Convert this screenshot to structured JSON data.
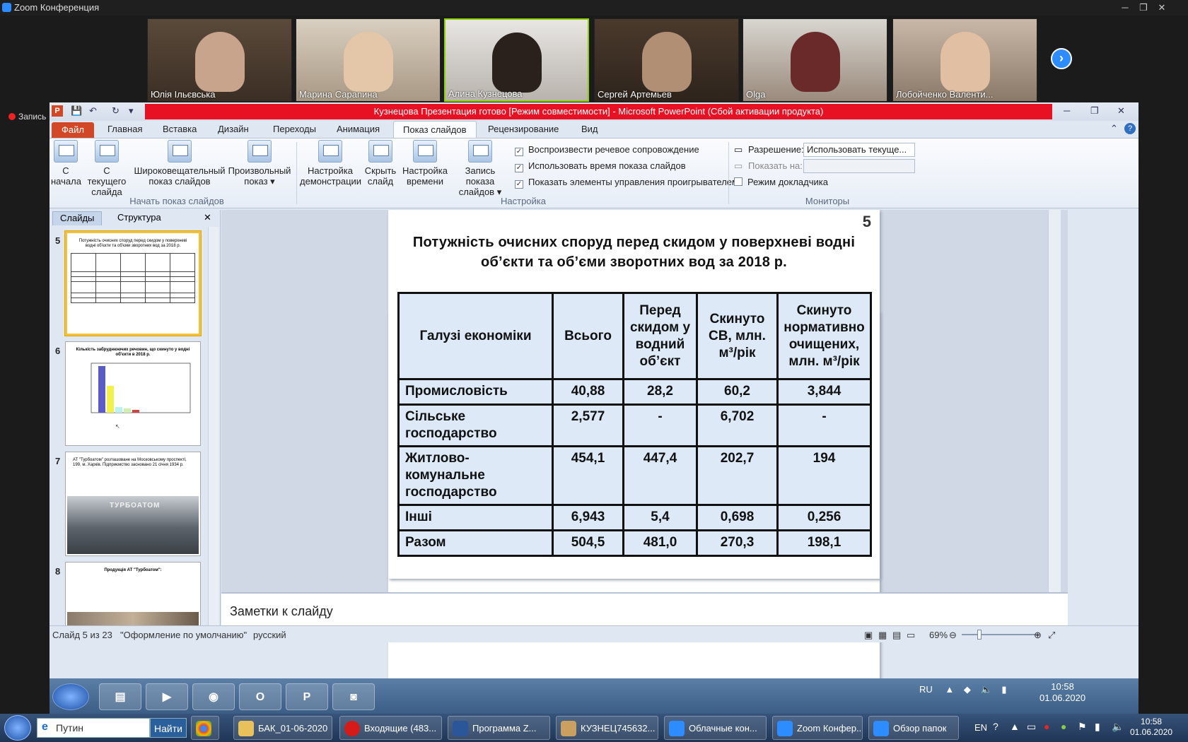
{
  "zoom": {
    "window_title": "Zoom Конференция",
    "recording_label": "Запись",
    "participants": [
      {
        "name": "Юлія Ільєвська"
      },
      {
        "name": "Марина Сарапина"
      },
      {
        "name": "Алина Кузнецова"
      },
      {
        "name": "Сергей Артемьев"
      },
      {
        "name": "Olga"
      },
      {
        "name": "Лобойченко Валенти..."
      }
    ]
  },
  "powerpoint": {
    "title": "Кузнецова Презентация готово [Режим совместимости] - Microsoft PowerPoint (Сбой активации продукта)",
    "tabs": [
      "Файл",
      "Главная",
      "Вставка",
      "Дизайн",
      "Переходы",
      "Анимация",
      "Показ слайдов",
      "Рецензирование",
      "Вид"
    ],
    "ribbon": {
      "start_group": {
        "label": "Начать показ слайдов",
        "buttons": [
          {
            "label1": "С",
            "label2": "начала"
          },
          {
            "label1": "С текущего",
            "label2": "слайда"
          },
          {
            "label1": "Широковещательный",
            "label2": "показ слайдов"
          },
          {
            "label1": "Произвольный",
            "label2": "показ ▾"
          }
        ]
      },
      "setup_group": {
        "label": "Настройка",
        "buttons": [
          {
            "label1": "Настройка",
            "label2": "демонстрации"
          },
          {
            "label1": "Скрыть",
            "label2": "слайд"
          },
          {
            "label1": "Настройка",
            "label2": "времени"
          },
          {
            "label1": "Запись показа",
            "label2": "слайдов ▾"
          }
        ],
        "checkboxes": [
          {
            "label": "Воспроизвести речевое сопровождение",
            "checked": "✓"
          },
          {
            "label": "Использовать время показа слайдов",
            "checked": "✓"
          },
          {
            "label": "Показать элементы управления проигрывателем",
            "checked": "✓"
          }
        ]
      },
      "monitors_group": {
        "label": "Мониторы",
        "resolution_label": "Разрешение:",
        "resolution_value": "Использовать текуще...",
        "show_on_label": "Показать на:",
        "show_on_value": "",
        "presenter_label": "Режим докладчика"
      }
    },
    "left_panel": {
      "tab_slides": "Слайды",
      "tab_outline": "Структура",
      "close": "✕",
      "thumbs": [
        {
          "num": "5",
          "title": "Потужність очисних споруд перед скидом у поверхневі водні об'єкти та об'єми зворотних вод за 2018 р."
        },
        {
          "num": "6",
          "title": "Кількість забруднюючих речовин, що скинуто у водні об'єкти в 2018 р."
        },
        {
          "num": "7",
          "title": "АТ \"Турбоатом\" розташоване на Московському проспекті, 199, м. Харків. Підприємство засновано 21 січня 1934 р.",
          "caption": "ТУРБОАТОМ"
        },
        {
          "num": "8",
          "title": "Продукція АТ \"Турбоатом\":"
        }
      ]
    },
    "slide": {
      "number": "5",
      "title": "Потужність очисних споруд перед скидом у поверхневі водні об’єкти та об’єми зворотних вод за 2018 р.",
      "headers": [
        "Галузі економіки",
        "Всього",
        "Перед скидом у водний об’єкт",
        "Скинуто СВ, млн. м³/рік",
        "Скинуто нормативно очищених, млн. м³/рік"
      ],
      "rows": [
        [
          "Промисловість",
          "40,88",
          "28,2",
          "60,2",
          "3,844"
        ],
        [
          "Сільське господарство",
          "2,577",
          "-",
          "6,702",
          "-"
        ],
        [
          "Житлово-комунальне господарство",
          "454,1",
          "447,4",
          "202,7",
          "194"
        ],
        [
          "Інші",
          "6,943",
          "5,4",
          "0,698",
          "0,256"
        ],
        [
          "Разом",
          "504,5",
          "481,0",
          "270,3",
          "198,1"
        ]
      ]
    },
    "notes_placeholder": "Заметки к слайду",
    "status": {
      "slide_of": "Слайд 5 из 23",
      "theme": "\"Оформление по умолчанию\"",
      "language": "русский",
      "zoom": "69%"
    }
  },
  "inner_taskbar": {
    "lang": "RU",
    "time": "10:58",
    "date": "01.06.2020"
  },
  "outer_taskbar": {
    "search_text": "Путин",
    "find_label": "Найти",
    "tasks": [
      "БАК_01-06-2020",
      "Входящие (483...",
      "Программа Z...",
      "КУЗНЕЦ745632...",
      "Облачные кон...",
      "Zoom Конфер...",
      "Обзор папок"
    ],
    "lang": "EN",
    "time": "10:58",
    "date": "01.06.2020"
  }
}
